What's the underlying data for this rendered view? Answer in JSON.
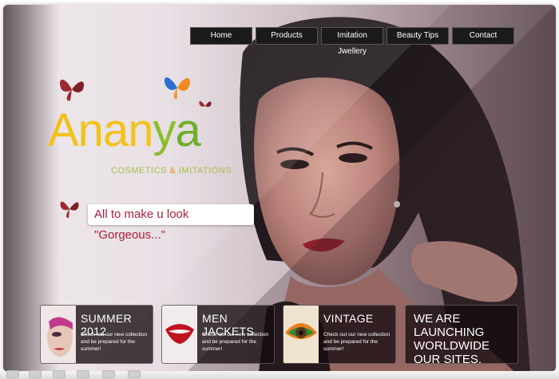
{
  "nav": {
    "items": [
      {
        "label": "Home"
      },
      {
        "label": "Products"
      },
      {
        "label": "Imitation Jwellery"
      },
      {
        "label": "Beauty Tips"
      },
      {
        "label": "Contact"
      }
    ]
  },
  "logo": {
    "word_part1": "Anan",
    "word_part2": "y",
    "word_part3": "a",
    "sub_part1": "COSMETICS ",
    "sub_amp": "&",
    "sub_part2": " IMITATIONS"
  },
  "tagline": "All to make u look \"Gorgeous...\"",
  "cards": [
    {
      "title": "SUMMER 2012",
      "text": "Check out our new collection and be prepared for the summer!"
    },
    {
      "title": "MEN JACKETS",
      "text": "Check out our new collection and be prepared for the summer!"
    },
    {
      "title": "VINTAGE",
      "text": "Check out our new collection and be prepared for the summer!"
    }
  ],
  "launch_card": {
    "text": "WE ARE LAUNCHING WORLDWIDE OUR SITES."
  },
  "colors": {
    "nav_bg": "#1a1a1a",
    "tagline_text": "#b01d3a",
    "logo_yellow": "#f3c21a",
    "logo_green": "#8bbf2a",
    "card_bg": "#140c0e"
  }
}
